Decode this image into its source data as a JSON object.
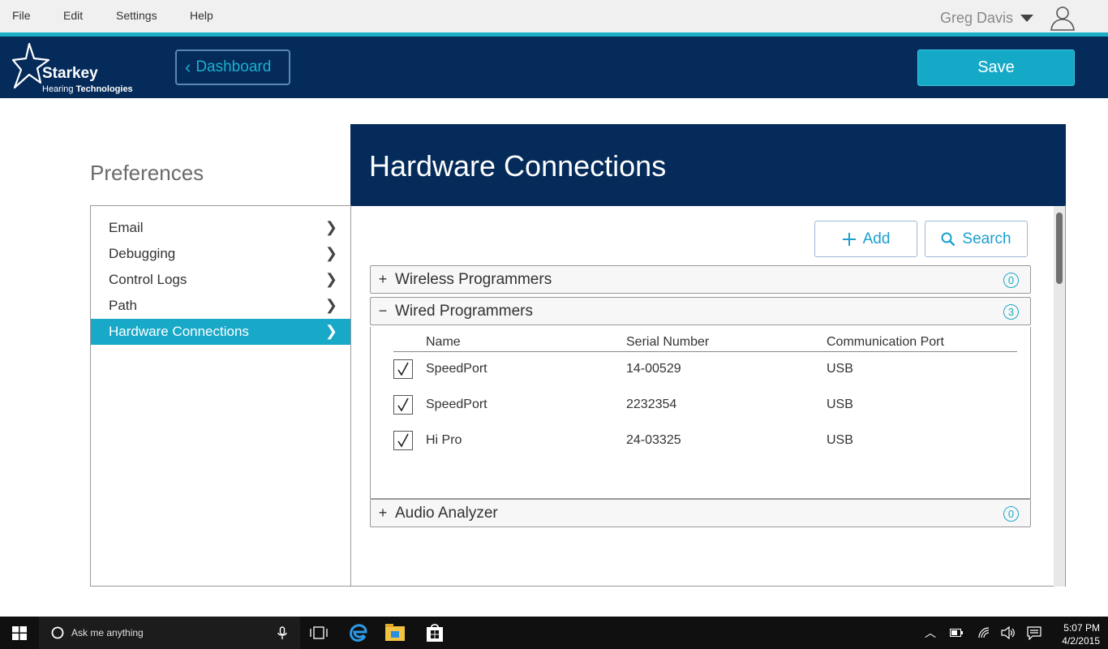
{
  "menu": {
    "items": [
      "File",
      "Edit",
      "Settings",
      "Help"
    ]
  },
  "user": {
    "name": "Greg Davis",
    "icon": "user-icon"
  },
  "brand": {
    "name": "Starkey",
    "sub_regular": "Hearing",
    "sub_bold": "Technologies"
  },
  "header": {
    "dashboard_label": "Dashboard",
    "save_label": "Save"
  },
  "preferences": {
    "title": "Preferences",
    "items": [
      {
        "label": "Email"
      },
      {
        "label": "Debugging"
      },
      {
        "label": "Control Logs"
      },
      {
        "label": "Path"
      },
      {
        "label": "Hardware Connections"
      }
    ],
    "active_index": 4
  },
  "content": {
    "title": "Hardware Connections",
    "add_label": "Add",
    "search_label": "Search",
    "sections": [
      {
        "symbol": "+",
        "label": "Wireless Programmers",
        "count": "0"
      },
      {
        "symbol": "−",
        "label": "Wired Programmers",
        "count": "3"
      },
      {
        "symbol": "+",
        "label": "Audio Analyzer",
        "count": "0"
      }
    ],
    "table": {
      "headers": [
        "Name",
        "Serial Number",
        "Communication Port"
      ],
      "rows": [
        {
          "name": "SpeedPort",
          "serial": "14-00529",
          "port": "USB",
          "checked": true
        },
        {
          "name": "SpeedPort",
          "serial": "2232354",
          "port": "USB",
          "checked": true
        },
        {
          "name": "Hi Pro",
          "serial": "24-03325",
          "port": "USB",
          "checked": true
        }
      ]
    }
  },
  "taskbar": {
    "search_placeholder": "Ask me anything",
    "time": "5:07 PM",
    "date": "4/2/2015"
  },
  "colors": {
    "navy": "#042b5a",
    "accent": "#18a8c8"
  }
}
